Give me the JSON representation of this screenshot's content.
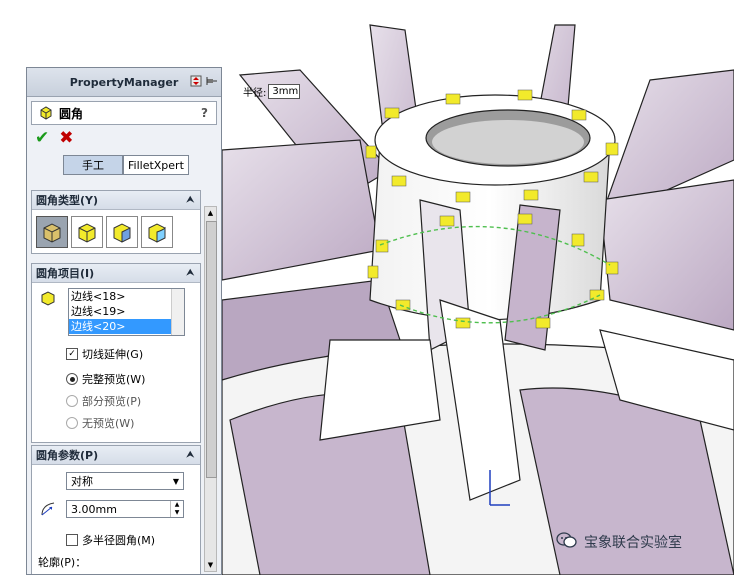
{
  "property_manager": {
    "title": "PropertyManager",
    "feature": {
      "name": "圆角",
      "help": "?"
    },
    "ok_symbol": "✔",
    "cancel_symbol": "✖",
    "mode_tabs": [
      {
        "label": "手工",
        "active": true
      },
      {
        "label": "FilletXpert",
        "active": false
      }
    ],
    "fillet_type": {
      "header": "圆角类型(Y)",
      "selected_index": 0
    },
    "fillet_items": {
      "header": "圆角项目(I)",
      "edges": [
        "边线<18>",
        "边线<19>",
        "边线<20>"
      ],
      "selected_edge_index": 2,
      "tangent_propagation": {
        "label": "切线延伸(G)",
        "checked": true
      },
      "preview_options": [
        {
          "label": "完整预览(W)",
          "selected": true
        },
        {
          "label": "部分预览(P)",
          "selected": false
        },
        {
          "label": "无预览(W)",
          "selected": false
        }
      ]
    },
    "fillet_params": {
      "header": "圆角参数(P)",
      "method": "对称",
      "radius": "3.00mm",
      "multi_radius": {
        "label": "多半径圆角(M)",
        "checked": false
      },
      "profile_label": "轮廓(P)："
    }
  },
  "viewport": {
    "radius_callout": {
      "label": "半径:",
      "value": "3mm"
    }
  },
  "watermark": {
    "text": "宝象联合实验室"
  },
  "colors": {
    "accent_green": "#1a9a1a",
    "cancel_red": "#c00000",
    "selected_row": "#3399ff",
    "blade_purple": "#cbbcd2",
    "highlight_yellow": "#f2ea2b"
  }
}
